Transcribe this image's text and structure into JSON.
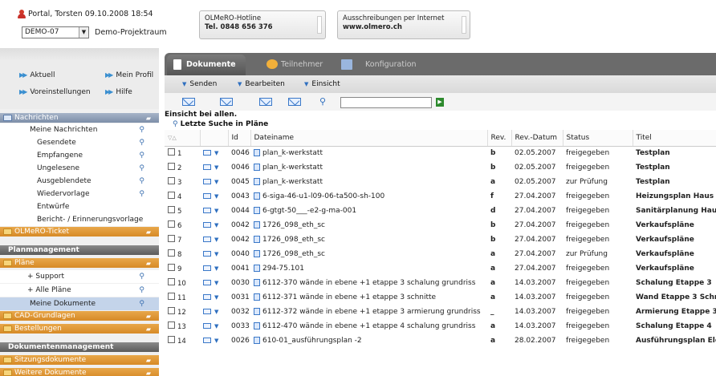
{
  "header": {
    "user": "Portal, Torsten",
    "datetime": "09.10.2008 18:54",
    "project_select": "DEMO-07",
    "project_name": "Demo-Projektraum",
    "hotline": {
      "label": "OLMeRO-Hotline",
      "value": "Tel. 0848 656 376"
    },
    "ausschreibungen": {
      "label": "Ausschreibungen per Internet",
      "value": "www.olmero.ch"
    }
  },
  "nav": {
    "aktuell": "Aktuell",
    "mein_profil": "Mein Profil",
    "voreinstellungen": "Voreinstellungen",
    "hilfe": "Hilfe"
  },
  "sidebar": {
    "nachrichten": "Nachrichten",
    "nachrichten_items": [
      "Meine Nachrichten",
      "Gesendete",
      "Empfangene",
      "Ungelesene",
      "Ausgeblendete",
      "Wiedervorlage",
      "Entwürfe",
      "Bericht- / Erinnerungsvorlage"
    ],
    "olmero_ticket": "OLMeRO-Ticket",
    "planmanagement": "Planmanagement",
    "plaene": "Pläne",
    "support": "+ Support",
    "alle_plaene": "+ Alle Pläne",
    "meine_dokumente": "Meine Dokumente",
    "cad": "CAD-Grundlagen",
    "bestellungen": "Bestellungen",
    "dokumentenmanagement": "Dokumentenmanagement",
    "sitzungsdokumente": "Sitzungsdokumente",
    "weitere": "Weitere Dokumente"
  },
  "tabs": {
    "dokumente": "Dokumente",
    "teilnehmer": "Teilnehmer",
    "konfiguration": "Konfiguration"
  },
  "menu": {
    "senden": "Senden",
    "bearbeiten": "Bearbeiten",
    "einsicht": "Einsicht"
  },
  "filter": "Einsicht bei allen.",
  "recent_search": "Letzte Suche in Pläne",
  "columns": {
    "sort": "▽△",
    "id": "Id",
    "dateiname": "Dateiname",
    "rev": "Rev.",
    "revdatum": "Rev.-Datum",
    "status": "Status",
    "titel": "Titel"
  },
  "rows": [
    {
      "n": "1",
      "id": "0046",
      "file": "plan_k-werkstatt",
      "rev": "b",
      "date": "02.05.2007",
      "status": "freigegeben",
      "title": "Testplan"
    },
    {
      "n": "2",
      "id": "0046",
      "file": "plan_k-werkstatt",
      "rev": "b",
      "date": "02.05.2007",
      "status": "freigegeben",
      "title": "Testplan"
    },
    {
      "n": "3",
      "id": "0045",
      "file": "plan_k-werkstatt",
      "rev": "a",
      "date": "02.05.2007",
      "status": "zur Prüfung",
      "title": "Testplan"
    },
    {
      "n": "4",
      "id": "0043",
      "file": "6-siga-46-u1-l09-06-ta500-sh-100",
      "rev": "f",
      "date": "27.04.2007",
      "status": "freigegeben",
      "title": "Heizungsplan Haus 1"
    },
    {
      "n": "5",
      "id": "0044",
      "file": "6-gtgt-50___-e2-g-ma-001",
      "rev": "d",
      "date": "27.04.2007",
      "status": "freigegeben",
      "title": "Sanitärplanung Haus"
    },
    {
      "n": "6",
      "id": "0042",
      "file": "1726_098_eth_sc",
      "rev": "b",
      "date": "27.04.2007",
      "status": "freigegeben",
      "title": "Verkaufspläne"
    },
    {
      "n": "7",
      "id": "0042",
      "file": "1726_098_eth_sc",
      "rev": "b",
      "date": "27.04.2007",
      "status": "freigegeben",
      "title": "Verkaufspläne"
    },
    {
      "n": "8",
      "id": "0040",
      "file": "1726_098_eth_sc",
      "rev": "a",
      "date": "27.04.2007",
      "status": "zur Prüfung",
      "title": "Verkaufspläne"
    },
    {
      "n": "9",
      "id": "0041",
      "file": "294-75.101",
      "rev": "a",
      "date": "27.04.2007",
      "status": "freigegeben",
      "title": "Verkaufspläne"
    },
    {
      "n": "10",
      "id": "0030",
      "file": "6112-370 wände in ebene +1 etappe 3 schalung grundriss",
      "rev": "a",
      "date": "14.03.2007",
      "status": "freigegeben",
      "title": "Schalung Etappe 3"
    },
    {
      "n": "11",
      "id": "0031",
      "file": "6112-371 wände in ebene +1 etappe 3 schnitte",
      "rev": "a",
      "date": "14.03.2007",
      "status": "freigegeben",
      "title": "Wand Etappe 3 Schn"
    },
    {
      "n": "12",
      "id": "0032",
      "file": "6112-372 wände in ebene +1 etappe 3 armierung grundriss",
      "rev": "_",
      "date": "14.03.2007",
      "status": "freigegeben",
      "title": "Armierung Etappe 3"
    },
    {
      "n": "13",
      "id": "0033",
      "file": "6112-470 wände in ebene +1 etappe 4 schalung grundriss",
      "rev": "a",
      "date": "14.03.2007",
      "status": "freigegeben",
      "title": "Schalung Etappe 4"
    },
    {
      "n": "14",
      "id": "0026",
      "file": "610-01_ausführungsplan -2",
      "rev": "a",
      "date": "28.02.2007",
      "status": "freigegeben",
      "title": "Ausführungsplan Ele"
    }
  ]
}
